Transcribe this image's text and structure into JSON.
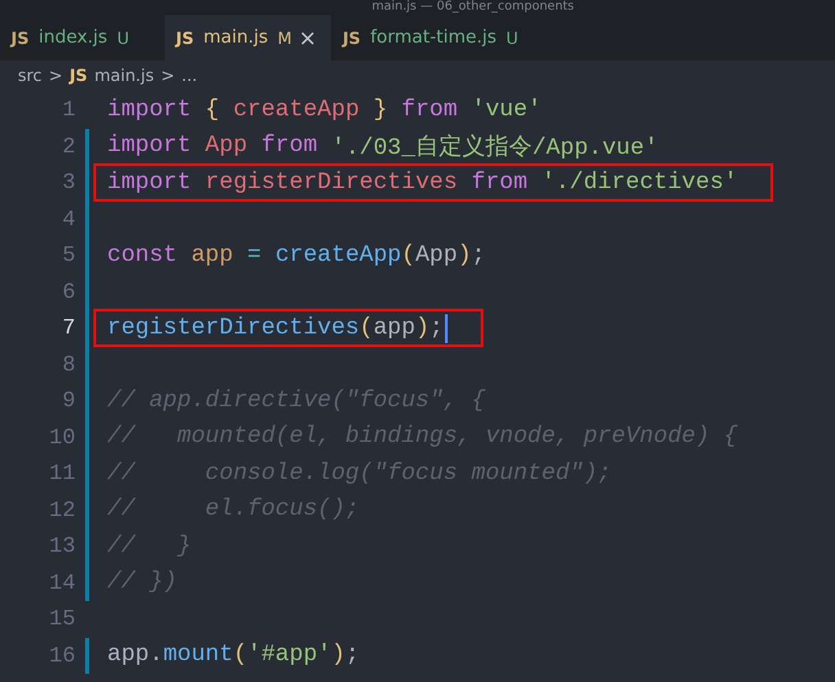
{
  "window": {
    "title": "main.js — 06_other_components"
  },
  "tabs": [
    {
      "icon": "JS",
      "label": "index.js",
      "badge": "U",
      "selected": false,
      "closable": false
    },
    {
      "icon": "JS",
      "label": "main.js",
      "badge": "M",
      "selected": true,
      "closable": true
    },
    {
      "icon": "JS",
      "label": "format-time.js",
      "badge": "U",
      "selected": false,
      "closable": false
    }
  ],
  "breadcrumb": {
    "folder": "src",
    "separator_1": ">",
    "icon": "JS",
    "file": "main.js",
    "separator_2": ">",
    "more": "..."
  },
  "lines": [
    {
      "number": "1",
      "changed": false,
      "boxed": false,
      "cursor": false,
      "tokens": [
        {
          "kind": "keyword",
          "text": "import "
        },
        {
          "kind": "bracket",
          "text": "{ "
        },
        {
          "kind": "name",
          "text": "createApp "
        },
        {
          "kind": "bracket",
          "text": "} "
        },
        {
          "kind": "keyword",
          "text": "from "
        },
        {
          "kind": "string",
          "text": "'vue'"
        }
      ]
    },
    {
      "number": "2",
      "changed": true,
      "boxed": false,
      "cursor": false,
      "tokens": [
        {
          "kind": "keyword",
          "text": "import "
        },
        {
          "kind": "name",
          "text": "App "
        },
        {
          "kind": "keyword",
          "text": "from "
        },
        {
          "kind": "string",
          "text": "'./03_自定义指令/App.vue'"
        }
      ]
    },
    {
      "number": "3",
      "changed": true,
      "boxed": true,
      "cursor": false,
      "tokens": [
        {
          "kind": "keyword",
          "text": "import "
        },
        {
          "kind": "name",
          "text": "registerDirectives "
        },
        {
          "kind": "keyword",
          "text": "from "
        },
        {
          "kind": "string",
          "text": "'./directives'"
        }
      ]
    },
    {
      "number": "4",
      "changed": true,
      "boxed": false,
      "cursor": false
    },
    {
      "number": "5",
      "changed": true,
      "boxed": false,
      "cursor": false,
      "tokens": [
        {
          "kind": "keyword",
          "text": "const "
        },
        {
          "kind": "variable",
          "text": "app "
        },
        {
          "kind": "operator",
          "text": "= "
        },
        {
          "kind": "function",
          "text": "createApp"
        },
        {
          "kind": "bracket",
          "text": "("
        },
        {
          "kind": "plain",
          "text": "App"
        },
        {
          "kind": "bracket",
          "text": ")"
        },
        {
          "kind": "plain",
          "text": ";"
        }
      ]
    },
    {
      "number": "6",
      "changed": true,
      "boxed": false,
      "cursor": false
    },
    {
      "number": "7",
      "changed": true,
      "boxed": true,
      "cursor": true,
      "tokens": [
        {
          "kind": "function",
          "text": "registerDirectives"
        },
        {
          "kind": "bracket",
          "text": "("
        },
        {
          "kind": "plain",
          "text": "app"
        },
        {
          "kind": "bracket",
          "text": ")"
        },
        {
          "kind": "plain",
          "text": ";"
        }
      ]
    },
    {
      "number": "8",
      "changed": true,
      "boxed": false,
      "cursor": false
    },
    {
      "number": "9",
      "changed": true,
      "boxed": false,
      "cursor": false,
      "tokens": [
        {
          "kind": "comment",
          "text": "// app.directive(\"focus\", {"
        }
      ]
    },
    {
      "number": "10",
      "changed": true,
      "boxed": false,
      "cursor": false,
      "tokens": [
        {
          "kind": "comment",
          "text": "//   mounted(el, bindings, vnode, preVnode) {"
        }
      ]
    },
    {
      "number": "11",
      "changed": true,
      "boxed": false,
      "cursor": false,
      "tokens": [
        {
          "kind": "comment",
          "text": "//     console.log(\"focus mounted\");"
        }
      ]
    },
    {
      "number": "12",
      "changed": true,
      "boxed": false,
      "cursor": false,
      "tokens": [
        {
          "kind": "comment",
          "text": "//     el.focus();"
        }
      ]
    },
    {
      "number": "13",
      "changed": true,
      "boxed": false,
      "cursor": false,
      "tokens": [
        {
          "kind": "comment",
          "text": "//   }"
        }
      ]
    },
    {
      "number": "14",
      "changed": true,
      "boxed": false,
      "cursor": false,
      "tokens": [
        {
          "kind": "comment",
          "text": "// })"
        }
      ]
    },
    {
      "number": "15",
      "changed": false,
      "boxed": false,
      "cursor": false
    },
    {
      "number": "16",
      "changed": true,
      "boxed": false,
      "cursor": false,
      "tokens": [
        {
          "kind": "plain",
          "text": "app."
        },
        {
          "kind": "function",
          "text": "mount"
        },
        {
          "kind": "bracket",
          "text": "("
        },
        {
          "kind": "string",
          "text": "'#app'"
        },
        {
          "kind": "bracket",
          "text": ")"
        },
        {
          "kind": "plain",
          "text": ";"
        }
      ]
    }
  ]
}
